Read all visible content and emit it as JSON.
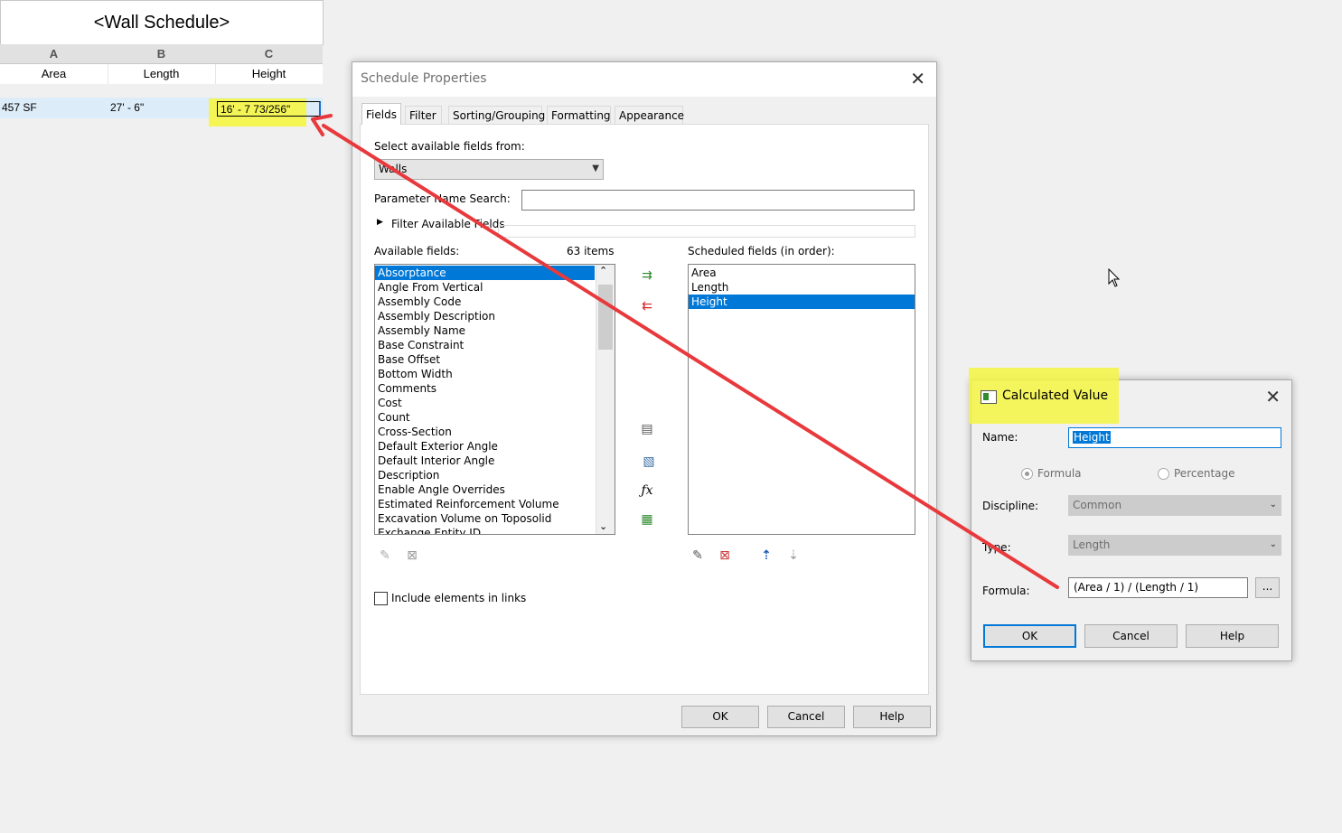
{
  "schedule": {
    "title": "<Wall Schedule>",
    "columns": [
      "A",
      "B",
      "C"
    ],
    "headers": [
      "Area",
      "Length",
      "Height"
    ],
    "row": [
      "457 SF",
      "27' - 6\"",
      "16' - 7 73/256\""
    ]
  },
  "schedule_properties": {
    "title": "Schedule Properties",
    "tabs": [
      "Fields",
      "Filter",
      "Sorting/Grouping",
      "Formatting",
      "Appearance"
    ],
    "select_from_label": "Select available fields from:",
    "select_from_value": "Walls",
    "param_search_label": "Parameter Name Search:",
    "filter_available_label": "Filter Available Fields",
    "available_label": "Available fields:",
    "items_count": "63 items",
    "available_fields": [
      "Absorptance",
      "Angle From Vertical",
      "Assembly Code",
      "Assembly Description",
      "Assembly Name",
      "Base Constraint",
      "Base Offset",
      "Bottom Width",
      "Comments",
      "Cost",
      "Count",
      "Cross-Section",
      "Default Exterior Angle",
      "Default Interior Angle",
      "Description",
      "Enable Angle Overrides",
      "Estimated Reinforcement Volume",
      "Excavation Volume on Toposolid",
      "Exchange Entity ID"
    ],
    "scheduled_label": "Scheduled fields (in order):",
    "scheduled_fields": [
      "Area",
      "Length",
      "Height"
    ],
    "include_links_label": "Include elements in links",
    "ok": "OK",
    "cancel": "Cancel",
    "help": "Help"
  },
  "calculated_value": {
    "title": "Calculated Value",
    "name_label": "Name:",
    "name_value": "Height",
    "formula_radio": "Formula",
    "percentage_radio": "Percentage",
    "discipline_label": "Discipline:",
    "discipline_value": "Common",
    "type_label": "Type:",
    "type_value": "Length",
    "formula_label": "Formula:",
    "formula_value": "(Area / 1) / (Length / 1)",
    "browse": "...",
    "ok": "OK",
    "cancel": "Cancel",
    "help": "Help"
  },
  "colors": {
    "highlight": "#f5f542",
    "arrow": "#e8393c",
    "selection": "#0078d7"
  }
}
